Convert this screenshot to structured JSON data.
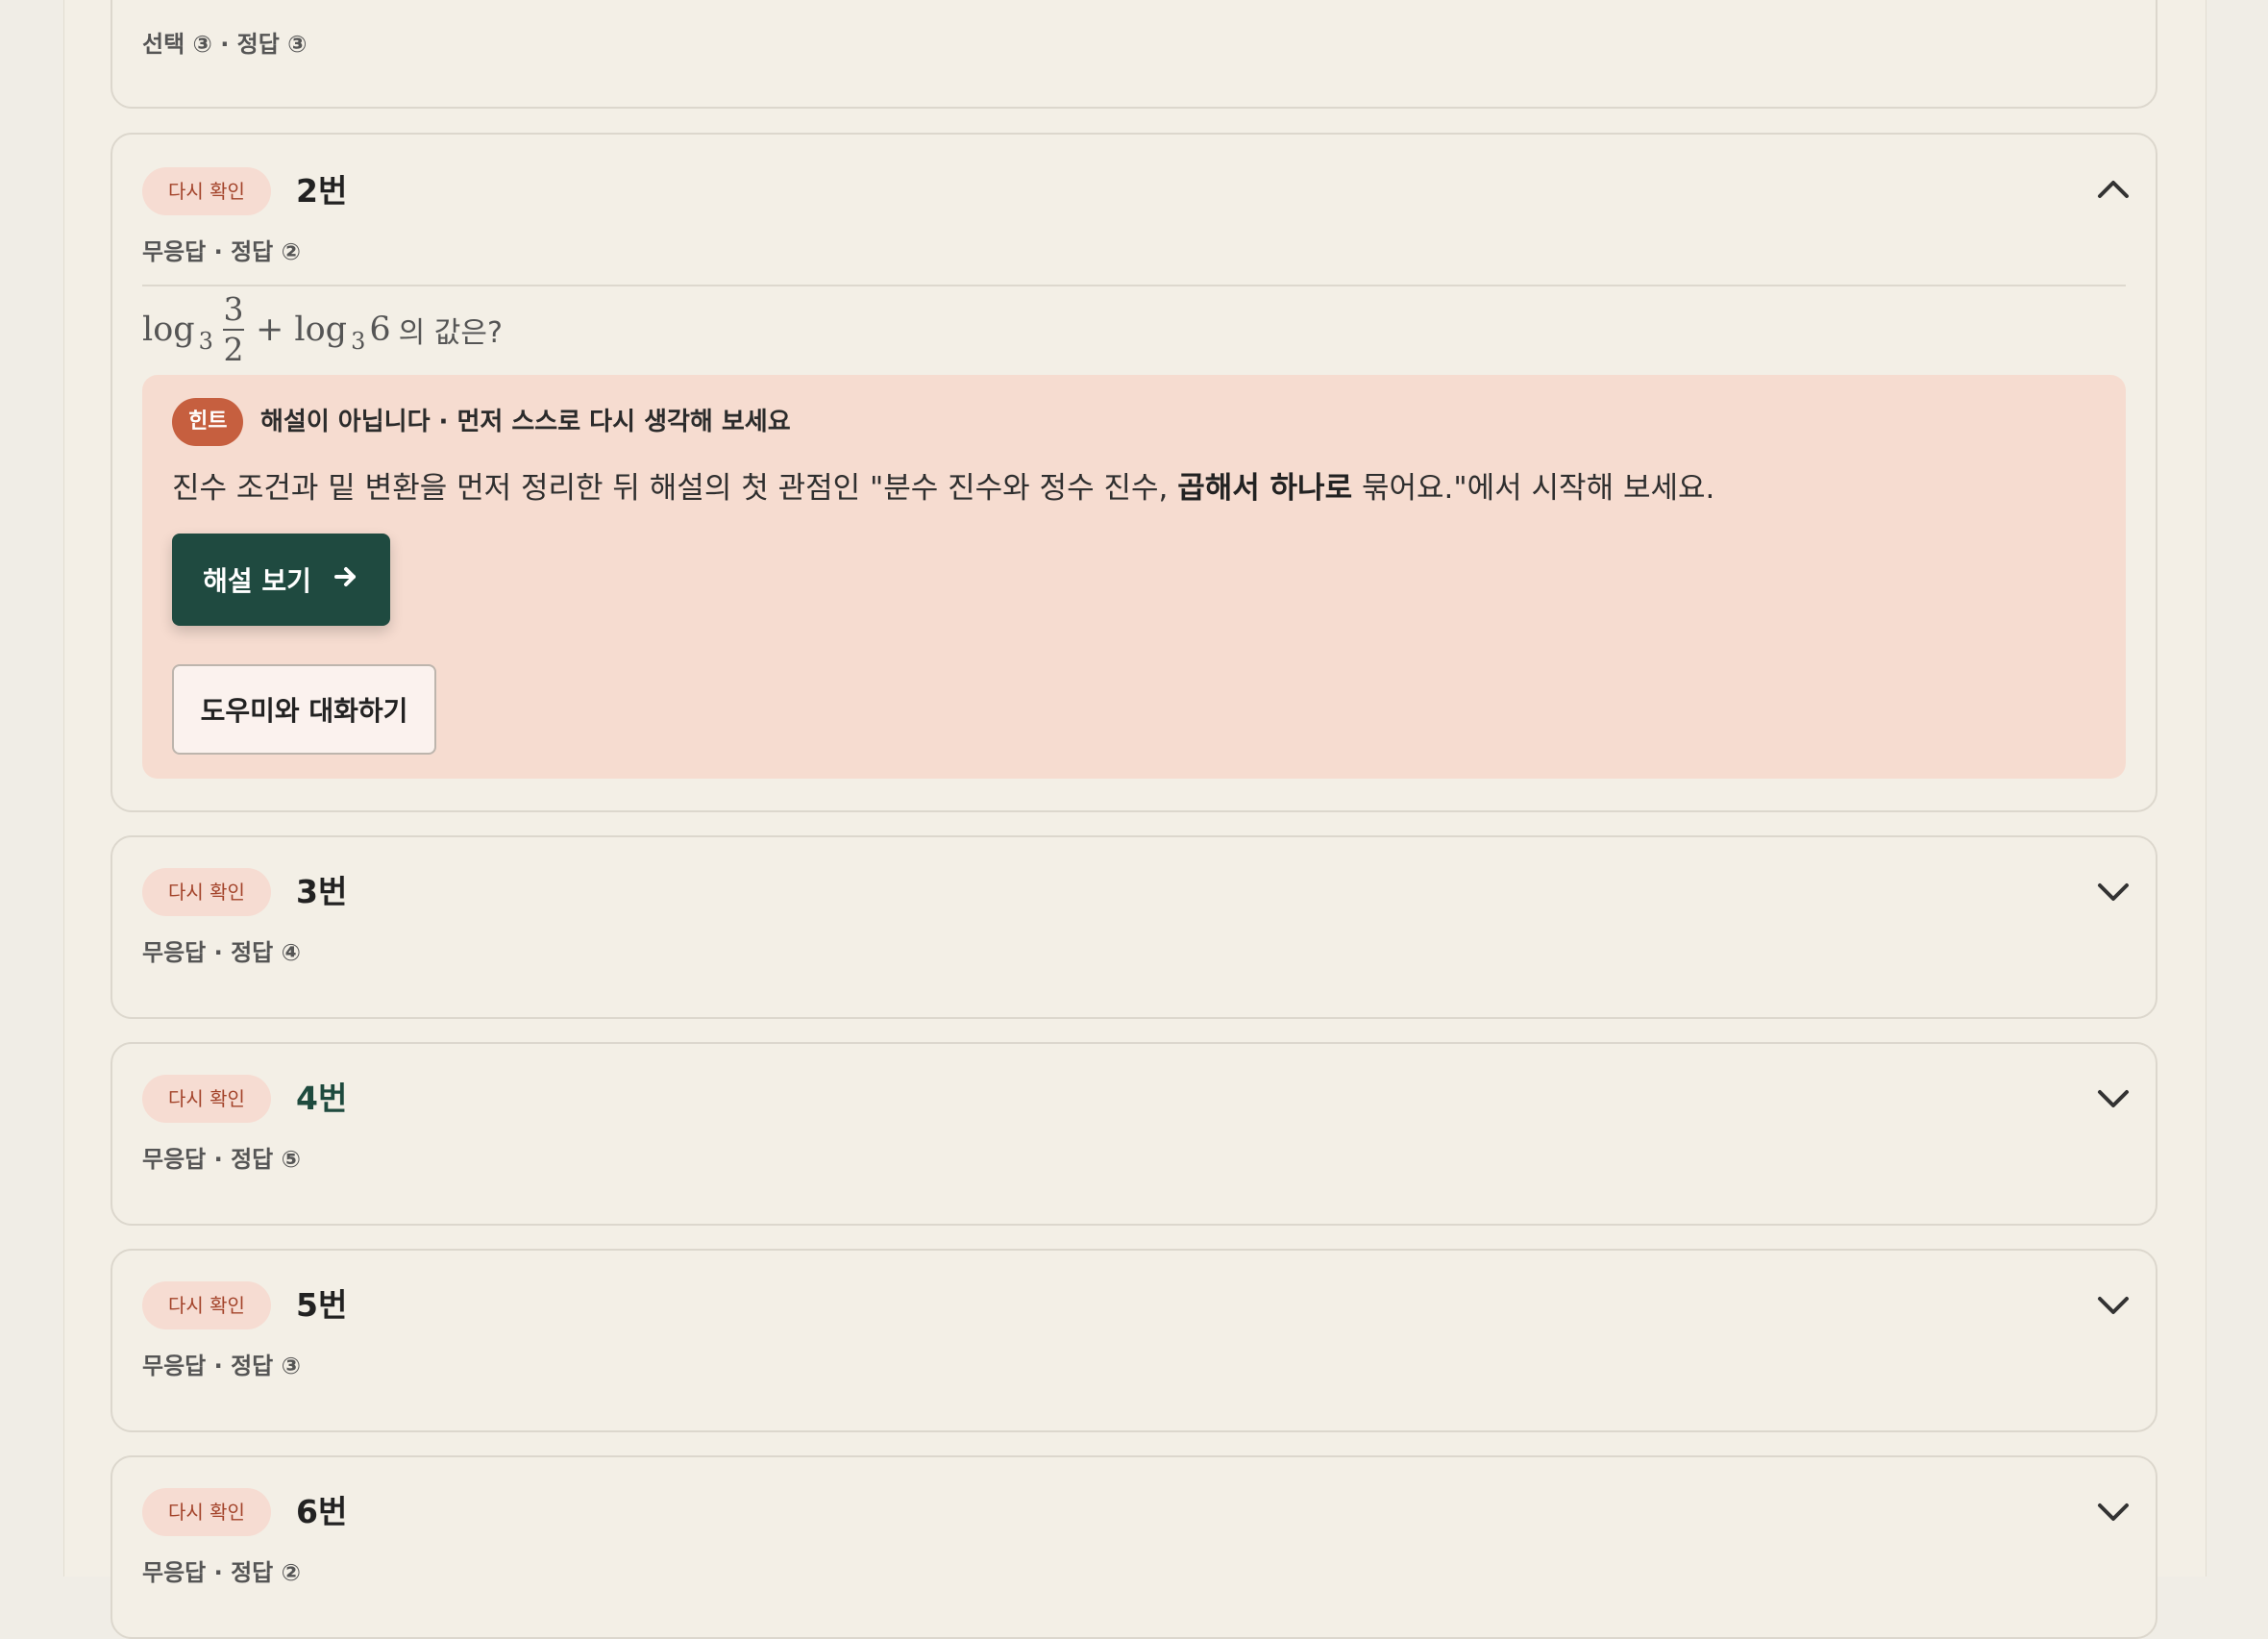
{
  "card1": {
    "meta": "선택 ③ · 정답 ③"
  },
  "card2": {
    "badge": "다시 확인",
    "number": "2번",
    "meta": "무응답 · 정답 ②",
    "question": {
      "log1": "log",
      "base1": "3",
      "frac_num": "3",
      "frac_den": "2",
      "plus_log": "+ log",
      "base2": "3",
      "arg2": "6",
      "suffix": "의 값은?"
    },
    "hint": {
      "pill": "힌트",
      "title": "해설이 아닙니다 · 먼저 스스로 다시 생각해 보세요",
      "text_before": "진수 조건과 밑 변환을 먼저 정리한 뒤 해설의 첫 관점인 \"분수 진수와 정수 진수, ",
      "text_bold": "곱해서 하나로",
      "text_after": " 묶어요.\"에서 시작해 보세요.",
      "view_solution": "해설 보기",
      "chat": "도우미와 대화하기"
    }
  },
  "cards": [
    {
      "badge": "다시 확인",
      "number": "3번",
      "meta": "무응답 · 정답 ④"
    },
    {
      "badge": "다시 확인",
      "number": "4번",
      "meta": "무응답 · 정답 ⑤"
    },
    {
      "badge": "다시 확인",
      "number": "5번",
      "meta": "무응답 · 정답 ③"
    },
    {
      "badge": "다시 확인",
      "number": "6번",
      "meta": "무응답 · 정답 ②"
    }
  ],
  "colors": {
    "badge_bg": "#f6dcd2",
    "badge_text": "#a3432a",
    "primary_button": "#1f4a40",
    "hint_pill": "#c65f3f",
    "hint_bg": "#f6dcd0",
    "active_number": "#1e4a3e"
  },
  "icons": {
    "expanded": "chevron-up-icon",
    "collapsed": "chevron-down-icon",
    "button_arrow": "arrow-right-icon"
  }
}
